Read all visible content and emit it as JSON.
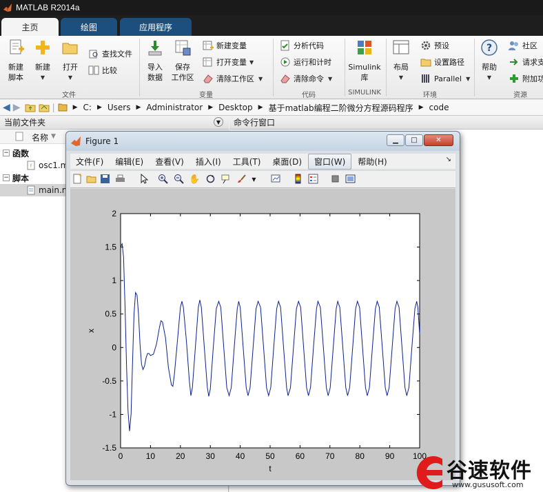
{
  "app": {
    "title": "MATLAB R2014a"
  },
  "ribbon": {
    "tabs": [
      {
        "label": "主页"
      },
      {
        "label": "绘图"
      },
      {
        "label": "应用程序"
      }
    ],
    "file_section": {
      "new_script": "新建\n脚本",
      "new": "新建",
      "open": "打开",
      "find_files": "查找文件",
      "compare": "比较",
      "label": "文件"
    },
    "variable_section": {
      "import_data": "导入\n数据",
      "save_workspace": "保存\n工作区",
      "new_variable": "新建变量",
      "open_variable": "打开变量",
      "clear_workspace": "清除工作区",
      "label": "变量"
    },
    "code_section": {
      "analyze_code": "分析代码",
      "run_and_time": "运行和计时",
      "clear_commands": "清除命令",
      "label": "代码"
    },
    "simulink_section": {
      "simulink_library": "Simulink\n库",
      "label": "SIMULINK"
    },
    "environment_section": {
      "layout": "布局",
      "preferences": "预设",
      "set_path": "设置路径",
      "parallel": "Parallel",
      "label": "环境"
    },
    "resources_section": {
      "help": "帮助",
      "community": "社区",
      "request_support": "请求支",
      "add_ons": "附加功",
      "label": "资源"
    }
  },
  "address": {
    "crumbs": [
      "C:",
      "Users",
      "Administrator",
      "Desktop",
      "基于matlab编程二阶微分方程源码程序",
      "code"
    ]
  },
  "current_folder": {
    "title": "当前文件夹",
    "column_name": "名称",
    "groups": [
      {
        "label": "函数",
        "files": [
          "osc1.m"
        ]
      },
      {
        "label": "脚本",
        "files": [
          "main.m"
        ]
      }
    ],
    "file_osc1_visible": "osc1.m",
    "file_main_visible": "main.m"
  },
  "command_window": {
    "title": "命令行窗口"
  },
  "figure": {
    "title": "Figure 1",
    "menu": [
      "文件(F)",
      "编辑(E)",
      "查看(V)",
      "插入(I)",
      "工具(T)",
      "桌面(D)",
      "窗口(W)",
      "帮助(H)"
    ],
    "toolbar_icons": [
      "new-figure-icon",
      "open-file-icon",
      "save-icon",
      "print-icon",
      "pointer-icon",
      "zoom-in-icon",
      "zoom-out-icon",
      "pan-icon",
      "rotate-icon",
      "data-cursor-icon",
      "brush-icon",
      "link-plot-icon",
      "colorbar-icon",
      "legend-icon",
      "hide-plot-tools-icon",
      "show-plot-tools-icon"
    ]
  },
  "colors": {
    "line": "#0a1f8f",
    "tab_inactive": "#1c4f7d",
    "title_bg": "#1a1a1a",
    "watermark_red": "#e01b1b"
  },
  "chart_data": {
    "type": "line",
    "title": "",
    "xlabel": "t",
    "ylabel": "x",
    "xlim": [
      0,
      100
    ],
    "ylim": [
      -1.5,
      2
    ],
    "xticks": [
      "0",
      "10",
      "20",
      "30",
      "40",
      "50",
      "60",
      "70",
      "80",
      "90",
      "100"
    ],
    "yticks": [
      "-1.5",
      "-1",
      "-0.5",
      "0",
      "0.5",
      "1",
      "1.5",
      "2"
    ],
    "grid": false,
    "series": [
      {
        "values": [
          [
            0,
            1.5
          ],
          [
            0.5,
            1.55
          ],
          [
            1,
            1.35
          ],
          [
            1.5,
            0.6
          ],
          [
            2,
            -0.3
          ],
          [
            2.5,
            -0.95
          ],
          [
            3,
            -1.25
          ],
          [
            3.5,
            -1.0
          ],
          [
            4,
            -0.2
          ],
          [
            4.5,
            0.5
          ],
          [
            5,
            0.82
          ],
          [
            5.5,
            0.78
          ],
          [
            6,
            0.5
          ],
          [
            6.5,
            0.05
          ],
          [
            7,
            -0.25
          ],
          [
            7.5,
            -0.33
          ],
          [
            8,
            -0.28
          ],
          [
            8.5,
            -0.16
          ],
          [
            9,
            -0.09
          ],
          [
            9.5,
            -0.09
          ],
          [
            10,
            -0.12
          ],
          [
            11,
            -0.1
          ],
          [
            12,
            0.05
          ],
          [
            13,
            0.3
          ],
          [
            13.5,
            0.4
          ],
          [
            14,
            0.38
          ],
          [
            15,
            0.15
          ],
          [
            16,
            -0.3
          ],
          [
            17,
            -0.56
          ],
          [
            17.5,
            -0.58
          ],
          [
            18,
            -0.4
          ],
          [
            19,
            0.1
          ],
          [
            20,
            0.6
          ],
          [
            20.5,
            0.69
          ],
          [
            21,
            0.6
          ],
          [
            22,
            0.1
          ],
          [
            23,
            -0.5
          ],
          [
            23.5,
            -0.72
          ],
          [
            24,
            -0.6
          ],
          [
            25,
            0.0
          ],
          [
            26,
            0.6
          ],
          [
            26.5,
            0.71
          ],
          [
            27,
            0.6
          ],
          [
            28,
            0.0
          ],
          [
            29,
            -0.6
          ],
          [
            29.5,
            -0.73
          ],
          [
            30,
            -0.62
          ],
          [
            31,
            0.0
          ],
          [
            32,
            0.58
          ],
          [
            32.8,
            0.69
          ],
          [
            33.5,
            0.6
          ],
          [
            34.5,
            0.0
          ],
          [
            35.5,
            -0.6
          ],
          [
            36.3,
            -0.72
          ],
          [
            37,
            -0.6
          ],
          [
            38,
            0.0
          ],
          [
            39,
            0.58
          ],
          [
            39.5,
            0.69
          ],
          [
            40,
            0.6
          ],
          [
            41,
            0.0
          ],
          [
            42,
            -0.6
          ],
          [
            42.6,
            -0.72
          ],
          [
            43.3,
            -0.6
          ],
          [
            44.3,
            0.0
          ],
          [
            45.3,
            0.58
          ],
          [
            46,
            0.69
          ],
          [
            46.8,
            0.6
          ],
          [
            47.8,
            0.0
          ],
          [
            48.8,
            -0.6
          ],
          [
            49.5,
            -0.72
          ],
          [
            50.2,
            -0.6
          ],
          [
            51.2,
            0.0
          ],
          [
            52.2,
            0.58
          ],
          [
            52.8,
            0.69
          ],
          [
            53.5,
            0.6
          ],
          [
            54.5,
            0.0
          ],
          [
            55.5,
            -0.6
          ],
          [
            56,
            -0.72
          ],
          [
            56.8,
            -0.6
          ],
          [
            57.8,
            0.0
          ],
          [
            58.8,
            0.58
          ],
          [
            59.5,
            0.69
          ],
          [
            60.2,
            0.6
          ],
          [
            61.2,
            0.0
          ],
          [
            62.2,
            -0.6
          ],
          [
            62.8,
            -0.72
          ],
          [
            63.5,
            -0.6
          ],
          [
            64.5,
            0.0
          ],
          [
            65.5,
            0.58
          ],
          [
            66,
            0.69
          ],
          [
            66.8,
            0.6
          ],
          [
            67.8,
            0.0
          ],
          [
            68.8,
            -0.6
          ],
          [
            69.4,
            -0.72
          ],
          [
            70.1,
            -0.6
          ],
          [
            71.1,
            0.0
          ],
          [
            72.1,
            0.58
          ],
          [
            72.6,
            0.69
          ],
          [
            73.3,
            0.6
          ],
          [
            74.3,
            0.0
          ],
          [
            75.3,
            -0.6
          ],
          [
            75.9,
            -0.72
          ],
          [
            76.6,
            -0.6
          ],
          [
            77.6,
            0.0
          ],
          [
            78.6,
            0.58
          ],
          [
            79.2,
            0.69
          ],
          [
            79.9,
            0.6
          ],
          [
            80.9,
            0.0
          ],
          [
            81.9,
            -0.6
          ],
          [
            82.5,
            -0.72
          ],
          [
            83.2,
            -0.6
          ],
          [
            84.2,
            0.0
          ],
          [
            85.2,
            0.58
          ],
          [
            85.8,
            0.69
          ],
          [
            86.5,
            0.6
          ],
          [
            87.5,
            0.0
          ],
          [
            88.5,
            -0.6
          ],
          [
            89.1,
            -0.72
          ],
          [
            89.8,
            -0.6
          ],
          [
            90.8,
            0.0
          ],
          [
            91.8,
            0.58
          ],
          [
            92.4,
            0.69
          ],
          [
            93.1,
            0.6
          ],
          [
            94.1,
            0.0
          ],
          [
            95.1,
            -0.6
          ],
          [
            95.7,
            -0.72
          ],
          [
            96.4,
            -0.6
          ],
          [
            97.4,
            0.0
          ],
          [
            98.4,
            0.58
          ],
          [
            99,
            0.69
          ],
          [
            99.4,
            0.6
          ],
          [
            100,
            0.2
          ]
        ]
      }
    ]
  },
  "watermark": {
    "name": "谷速软件",
    "url": "www.gususoft.com"
  }
}
